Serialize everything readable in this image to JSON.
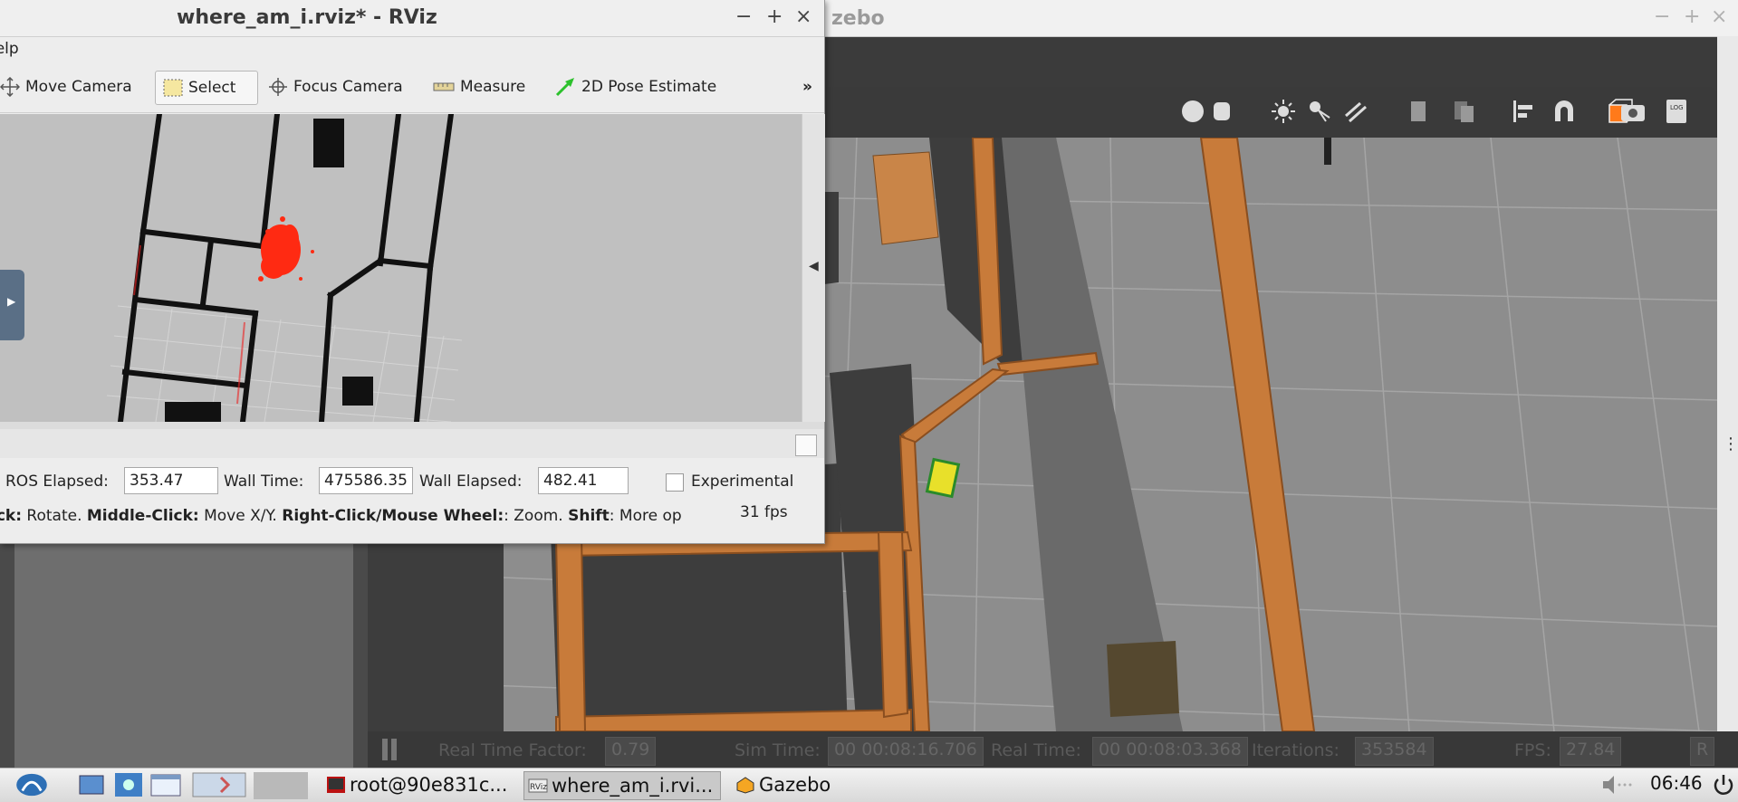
{
  "gazebo": {
    "title": "Gazebo",
    "title_visible": "zebo",
    "window_controls": [
      "−",
      "+",
      "×"
    ],
    "status": {
      "real_time_factor_label": "Real Time Factor:",
      "real_time_factor": "0.79",
      "sim_time_label": "Sim Time:",
      "sim_time": "00 00:08:16.706",
      "real_time_label": "Real Time:",
      "real_time": "00 00:08:03.368",
      "iterations_label": "Iterations:",
      "iterations": "353584",
      "fps_label": "FPS:",
      "fps": "27.84",
      "reset_label": "R"
    },
    "toolbar_icons": [
      "sphere-icon",
      "cylinder-icon",
      "sun-light-icon",
      "spot-light-icon",
      "directional-light-icon",
      "copy-icon",
      "paste-icon",
      "align-icon",
      "snap-magnet-icon",
      "view-angle-icon",
      "screenshot-icon",
      "log-icon"
    ],
    "colors": {
      "wall": "#c87b3a",
      "floor": "#8d8d8d",
      "shadow": "#3d3d3d",
      "robot": "#e8e02a"
    }
  },
  "rviz": {
    "title": "where_am_i.rviz* - RViz",
    "window_controls": [
      "−",
      "+",
      "×"
    ],
    "menu_help": "Help",
    "menu_help_visible": "lelp",
    "tools": {
      "move_camera": "Move Camera",
      "select": "Select",
      "focus_camera": "Focus Camera",
      "measure": "Measure",
      "pose_estimate": "2D Pose Estimate",
      "more": "»"
    },
    "time": {
      "ros_elapsed_label": "ROS Elapsed:",
      "ros_elapsed": "353.47",
      "wall_time_label": "Wall Time:",
      "wall_time": "475586.35",
      "wall_elapsed_label": "Wall Elapsed:",
      "wall_elapsed": "482.41",
      "experimental_label": "Experimental"
    },
    "help": {
      "rotate_key": "ick:",
      "rotate": " Rotate. ",
      "middle_key": "Middle-Click:",
      "middle": " Move X/Y. ",
      "right_key": "Right-Click/Mouse Wheel:",
      "right": ": Zoom. ",
      "shift_key": "Shift",
      "shift": ": More op",
      "fps": "31 fps"
    },
    "colors": {
      "particles": "#ff2a12",
      "map_bg": "#c0c0c0",
      "walls": "#111111"
    }
  },
  "taskbar": {
    "tasks": [
      {
        "label": "root@90e831c...",
        "icon": "terminal-icon"
      },
      {
        "label": "where_am_i.rvi...",
        "icon": "rviz-icon"
      },
      {
        "label": "Gazebo",
        "icon": "gazebo-icon"
      }
    ],
    "clock": "06:46"
  }
}
